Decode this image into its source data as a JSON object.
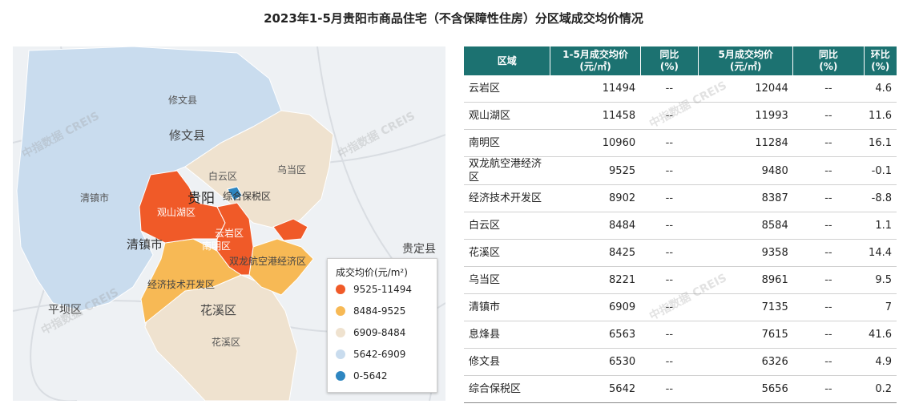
{
  "title": "2023年1-5月贵阳市商品住宅（不含保障性住房）分区域成交均价情况",
  "watermark": "中指数据 CREIS",
  "legend": {
    "title": "成交均价(元/m²)",
    "items": [
      {
        "label": "9525-11494",
        "color": "#f05a28"
      },
      {
        "label": "8484-9525",
        "color": "#f7b955"
      },
      {
        "label": "6909-8484",
        "color": "#efe2cf"
      },
      {
        "label": "5642-6909",
        "color": "#c9dcee"
      },
      {
        "label": "0-5642",
        "color": "#2e86c1"
      }
    ]
  },
  "map_labels": {
    "xiuwen_small": "修文县",
    "xiuwen_big": "修文县",
    "qingzhen": "清镇市",
    "qingzhen_big": "清镇市",
    "baiyun": "白云区",
    "wudang": "乌当区",
    "guiyang": "贵阳",
    "guanshanhu": "观山湖区",
    "zonghe": "综合保税区",
    "nanming": "南明区",
    "yunyan": "云岩区",
    "shuanglong": "双龙航空港经济区",
    "jingji": "经济技术开发区",
    "huaxi_big": "花溪区",
    "huaxi_small": "花溪区",
    "pingba": "平坝区",
    "guiding": "贵定县"
  },
  "chart_data": {
    "type": "table",
    "title": "2023年1-5月贵阳市商品住宅（不含保障性住房）分区域成交均价情况",
    "headers": {
      "region": "区域",
      "avg15_line1": "1-5月成交均价",
      "avg15_line2": "(元/㎡)",
      "yoy1_line1": "同比",
      "yoy1_line2": "(%)",
      "may_line1": "5月成交均价",
      "may_line2": "(元/㎡)",
      "yoy2_line1": "同比",
      "yoy2_line2": "(%)",
      "mom_line1": "环比",
      "mom_line2": "(%)"
    },
    "rows": [
      {
        "region": "云岩区",
        "avg_jan_may": "11494",
        "yoy1": "--",
        "avg_may": "12044",
        "yoy2": "--",
        "mom": "4.6"
      },
      {
        "region": "观山湖区",
        "avg_jan_may": "11458",
        "yoy1": "--",
        "avg_may": "11993",
        "yoy2": "--",
        "mom": "11.6"
      },
      {
        "region": "南明区",
        "avg_jan_may": "10960",
        "yoy1": "--",
        "avg_may": "11284",
        "yoy2": "--",
        "mom": "16.1"
      },
      {
        "region": "双龙航空港经济区",
        "avg_jan_may": "9525",
        "yoy1": "--",
        "avg_may": "9480",
        "yoy2": "--",
        "mom": "-0.1"
      },
      {
        "region": "经济技术开发区",
        "avg_jan_may": "8902",
        "yoy1": "--",
        "avg_may": "8387",
        "yoy2": "--",
        "mom": "-8.8"
      },
      {
        "region": "白云区",
        "avg_jan_may": "8484",
        "yoy1": "--",
        "avg_may": "8584",
        "yoy2": "--",
        "mom": "1.1"
      },
      {
        "region": "花溪区",
        "avg_jan_may": "8425",
        "yoy1": "--",
        "avg_may": "9358",
        "yoy2": "--",
        "mom": "14.4"
      },
      {
        "region": "乌当区",
        "avg_jan_may": "8221",
        "yoy1": "--",
        "avg_may": "8961",
        "yoy2": "--",
        "mom": "9.5"
      },
      {
        "region": "清镇市",
        "avg_jan_may": "6909",
        "yoy1": "--",
        "avg_may": "7135",
        "yoy2": "--",
        "mom": "7"
      },
      {
        "region": "息烽县",
        "avg_jan_may": "6563",
        "yoy1": "--",
        "avg_may": "7615",
        "yoy2": "--",
        "mom": "41.6"
      },
      {
        "region": "修文县",
        "avg_jan_may": "6530",
        "yoy1": "--",
        "avg_may": "6326",
        "yoy2": "--",
        "mom": "4.9"
      },
      {
        "region": "综合保税区",
        "avg_jan_may": "5642",
        "yoy1": "--",
        "avg_may": "5656",
        "yoy2": "--",
        "mom": "0.2"
      }
    ]
  }
}
